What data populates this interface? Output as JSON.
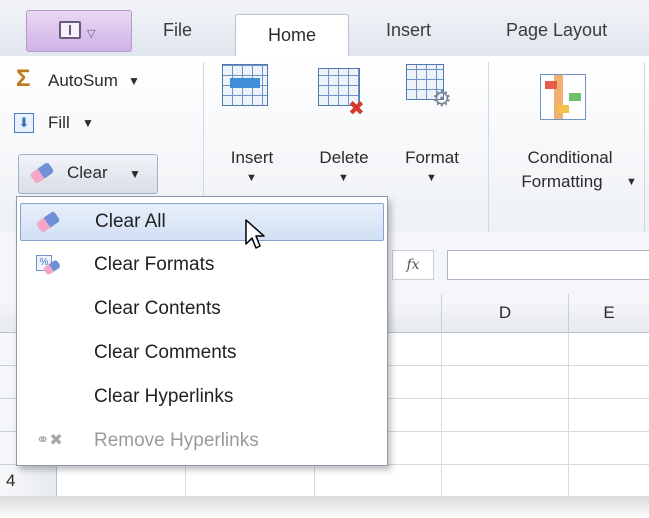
{
  "tabs": {
    "file": "File",
    "home": "Home",
    "insert": "Insert",
    "page_layout": "Page Layout"
  },
  "ribbon": {
    "autosum": "AutoSum",
    "fill": "Fill",
    "clear": "Clear",
    "insert": "Insert",
    "delete": "Delete",
    "format": "Format",
    "conditional_line1": "Conditional",
    "conditional_line2": "Formatting"
  },
  "formula_bar": {
    "fx": "fx"
  },
  "columns": [
    "D",
    "E"
  ],
  "rows": [
    "4"
  ],
  "menu": {
    "items": [
      {
        "label": "Clear All",
        "icon": "eraser-icon",
        "highlighted": true,
        "enabled": true
      },
      {
        "label": "Clear Formats",
        "icon": "clear-formats-icon",
        "highlighted": false,
        "enabled": true
      },
      {
        "label": "Clear Contents",
        "icon": "",
        "highlighted": false,
        "enabled": true
      },
      {
        "label": "Clear Comments",
        "icon": "",
        "highlighted": false,
        "enabled": true
      },
      {
        "label": "Clear Hyperlinks",
        "icon": "",
        "highlighted": false,
        "enabled": true
      },
      {
        "label": "Remove Hyperlinks",
        "icon": "remove-hyperlink-icon",
        "highlighted": false,
        "enabled": false
      }
    ]
  },
  "colors": {
    "highlight": "#d2e0f5",
    "highlight_border": "#86a3d1",
    "disabled_text": "#9a9a9a"
  }
}
